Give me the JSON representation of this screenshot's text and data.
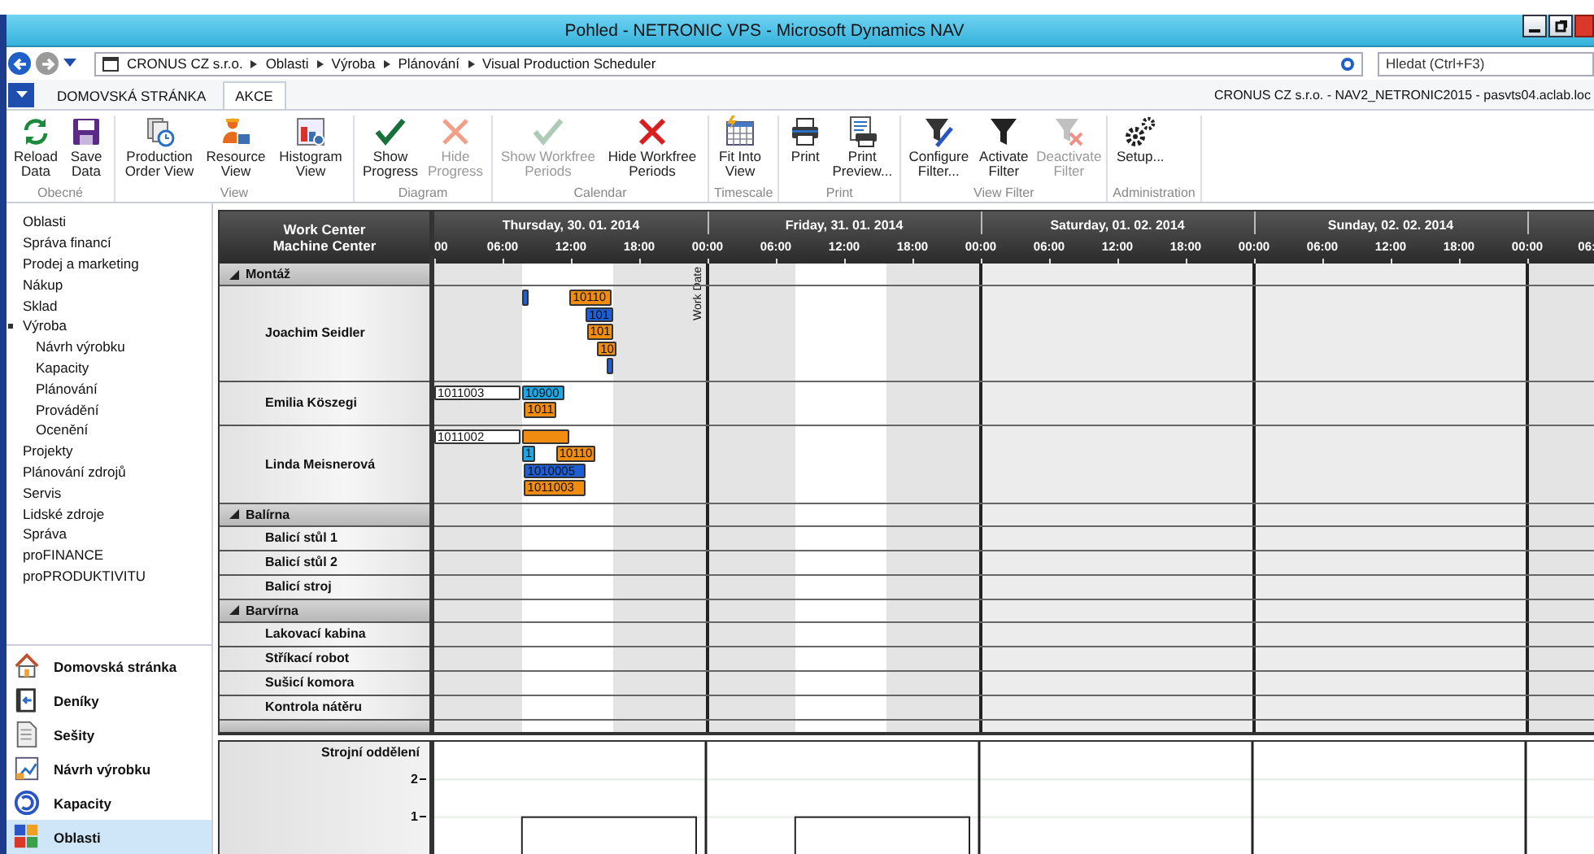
{
  "window": {
    "title": "Pohled - NETRONIC VPS - Microsoft Dynamics NAV"
  },
  "address_bar": {
    "breadcrumb": [
      "CRONUS CZ s.r.o.",
      "Oblasti",
      "Výroba",
      "Plánování",
      "Visual Production Scheduler"
    ]
  },
  "search": {
    "placeholder": "Hledat (Ctrl+F3)"
  },
  "tabs": [
    {
      "label": "DOMOVSKÁ STRÁNKA",
      "selected": false
    },
    {
      "label": "AKCE",
      "selected": true
    }
  ],
  "connection": "CRONUS CZ s.r.o. - NAV2_NETRONIC2015 - pasvts04.aclab.loc",
  "ribbon": [
    {
      "group": "Obecné",
      "buttons": [
        {
          "label": "Reload Data",
          "disabled": false
        },
        {
          "label": "Save Data",
          "disabled": false
        }
      ]
    },
    {
      "group": "View",
      "buttons": [
        {
          "label": "Production Order View",
          "disabled": false
        },
        {
          "label": "Resource View",
          "disabled": false
        },
        {
          "label": "Histogram View",
          "disabled": false
        }
      ]
    },
    {
      "group": "Diagram",
      "buttons": [
        {
          "label": "Show Progress",
          "disabled": false
        },
        {
          "label": "Hide Progress",
          "disabled": true
        }
      ]
    },
    {
      "group": "Calendar",
      "buttons": [
        {
          "label": "Show Workfree Periods",
          "disabled": true
        },
        {
          "label": "Hide Workfree Periods",
          "disabled": false
        }
      ]
    },
    {
      "group": "Timescale",
      "buttons": [
        {
          "label": "Fit Into View",
          "disabled": false
        }
      ]
    },
    {
      "group": "Print",
      "buttons": [
        {
          "label": "Print",
          "disabled": false
        },
        {
          "label": "Print Preview...",
          "disabled": false
        }
      ]
    },
    {
      "group": "View Filter",
      "buttons": [
        {
          "label": "Configure Filter...",
          "disabled": false
        },
        {
          "label": "Activate Filter",
          "disabled": false
        },
        {
          "label": "Deactivate Filter",
          "disabled": true
        }
      ]
    },
    {
      "group": "Administration",
      "buttons": [
        {
          "label": "Setup...",
          "disabled": false
        }
      ]
    }
  ],
  "navigation": {
    "items": [
      {
        "label": "Oblasti",
        "expanded": false
      },
      {
        "label": "Správa financí",
        "expanded": false
      },
      {
        "label": "Prodej a marketing",
        "expanded": false
      },
      {
        "label": "Nákup",
        "expanded": false
      },
      {
        "label": "Sklad",
        "expanded": false
      },
      {
        "label": "Výroba",
        "expanded": true,
        "children": [
          {
            "label": "Návrh výrobku"
          },
          {
            "label": "Kapacity"
          },
          {
            "label": "Plánování"
          },
          {
            "label": "Provádění"
          },
          {
            "label": "Ocenění"
          }
        ]
      },
      {
        "label": "Projekty",
        "expanded": false
      },
      {
        "label": "Plánování zdrojů",
        "expanded": false
      },
      {
        "label": "Servis",
        "expanded": false
      },
      {
        "label": "Lidské zdroje",
        "expanded": false
      },
      {
        "label": "Správa",
        "expanded": false
      },
      {
        "label": "proFINANCE",
        "expanded": false
      },
      {
        "label": "proPRODUKTIVITU",
        "expanded": false
      }
    ]
  },
  "nav_buttons": [
    {
      "label": "Domovská stránka",
      "selected": false
    },
    {
      "label": "Deníky",
      "selected": false
    },
    {
      "label": "Sešity",
      "selected": false
    },
    {
      "label": "Návrh výrobku",
      "selected": false
    },
    {
      "label": "Kapacity",
      "selected": false
    },
    {
      "label": "Oblasti",
      "selected": true
    }
  ],
  "scheduler": {
    "header": [
      "Work Center",
      "Machine Center"
    ],
    "days": [
      {
        "label": "Thursday, 30. 01. 2014",
        "workday": true
      },
      {
        "label": "Friday, 31. 01. 2014",
        "workday": true
      },
      {
        "label": "Saturday, 01. 02. 2014",
        "workday": false
      },
      {
        "label": "Sunday, 02. 02. 2014",
        "workday": false
      },
      {
        "workday": true
      }
    ],
    "hour_ticks": [
      "00",
      "06:00",
      "12:00",
      "18:00",
      "00:00",
      "06:00",
      "12:00",
      "18:00",
      "00:00",
      "06:00",
      "12:00",
      "18:00",
      "00:00",
      "06:00",
      "12:00",
      "18:00",
      "00:00",
      "06:"
    ],
    "work_date_label": "Work Date",
    "groups": [
      {
        "name": "Montáž",
        "expanded": true,
        "resources": [
          {
            "name": "Joachim Seidler",
            "bars": [
              {
                "color": "#1f5fd6"
              },
              {
                "label": "10110",
                "color": "#f08c10"
              },
              {
                "label": "101",
                "color": "#1f5fd6"
              },
              {
                "label": "101",
                "color": "#f08c10"
              },
              {
                "label": "10",
                "color": "#f08c10"
              },
              {
                "color": "#1f5fd6"
              }
            ]
          },
          {
            "name": "Emilia Köszegi",
            "bars": [
              {
                "label": "1011003",
                "color": "#ffffff"
              },
              {
                "label": "10900",
                "color": "#1aa8e8"
              },
              {
                "label": "1011",
                "color": "#f08c10"
              }
            ]
          },
          {
            "name": "Linda Meisnerová",
            "bars": [
              {
                "label": "1011002",
                "color": "#ffffff"
              },
              {
                "color": "#f08c10"
              },
              {
                "label": "1",
                "color": "#1aa8e8"
              },
              {
                "label": "10110",
                "color": "#f08c10"
              },
              {
                "label": "1010005",
                "color": "#1f5fd6"
              },
              {
                "label": "1011003",
                "color": "#f08c10"
              }
            ]
          }
        ]
      },
      {
        "name": "Balírna",
        "expanded": true,
        "resources": [
          {
            "name": "Balicí stůl 1"
          },
          {
            "name": "Balicí stůl 2"
          },
          {
            "name": "Balicí stroj"
          }
        ]
      },
      {
        "name": "Barvírna",
        "expanded": true,
        "resources": [
          {
            "name": "Lakovací kabina"
          },
          {
            "name": "Stříkací robot"
          },
          {
            "name": "Sušicí komora"
          },
          {
            "name": "Kontrola nátěru"
          }
        ]
      }
    ]
  },
  "histogram": {
    "title": "Strojní oddělení",
    "axis_labels": [
      "2",
      "1"
    ]
  }
}
